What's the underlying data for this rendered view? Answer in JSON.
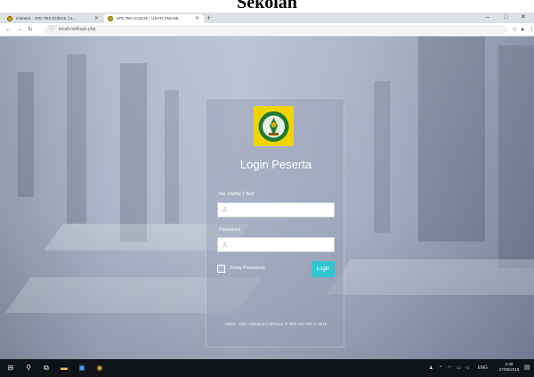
{
  "caption": {
    "text": "Sekolah"
  },
  "browser": {
    "tabs": [
      {
        "label": "Instrator... MTs TBS KUDUS | U...",
        "active": false
      },
      {
        "label": "MTs TBS KUDUS | UJIAN ONLINE",
        "active": true
      }
    ],
    "new_tab": "+",
    "url": "localhost/login.php",
    "window_controls": {
      "minimize": "–",
      "maximize": "□",
      "close": "✕"
    }
  },
  "login": {
    "title": "Login Peserta",
    "username": {
      "label": "No. Daftar / Test",
      "value": "",
      "placeholder": ""
    },
    "password": {
      "label": "Password",
      "value": "",
      "placeholder": ""
    },
    "show_password": "Show Password",
    "button": "Login",
    "footer": "TBSK - CBT Aplikation | @Team IT MTs NU TBS © 2018"
  },
  "taskbar": {
    "language": "ENG",
    "time": "3:38",
    "date": "27/08/2018"
  },
  "colors": {
    "accent": "#31c6cf",
    "logo_bg": "#f0d400",
    "logo_green": "#1d7a2e"
  }
}
